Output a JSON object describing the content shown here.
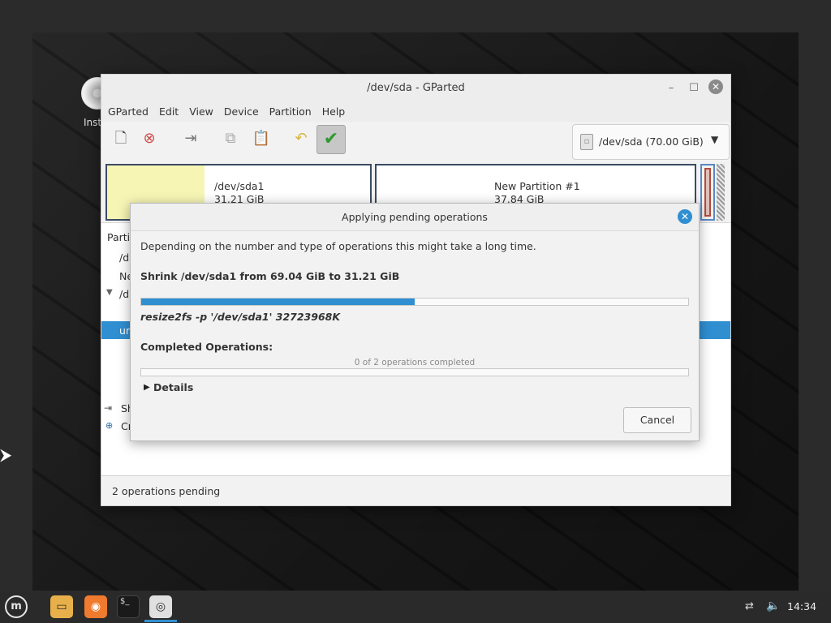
{
  "desktop": {
    "icon_label": "Inst"
  },
  "window": {
    "title": "/dev/sda - GParted",
    "menu": [
      "GParted",
      "Edit",
      "View",
      "Device",
      "Partition",
      "Help"
    ],
    "device_selector": "/dev/sda  (70.00 GiB)",
    "partitions": [
      {
        "name": "/dev/sda1",
        "size": "31.21 GiB"
      },
      {
        "name": "New Partition #1",
        "size": "37.84 GiB"
      }
    ],
    "list": {
      "header": "Parti",
      "rows": [
        "/d",
        "Ne",
        "/d"
      ],
      "selected_row": "un"
    },
    "operations": {
      "row1": "Sh",
      "row2": "Cr"
    },
    "status": "2 operations pending"
  },
  "dialog": {
    "title": "Applying pending operations",
    "description": "Depending on the number and type of operations this might take a long time.",
    "current_operation": "Shrink /dev/sda1 from 69.04 GiB to 31.21 GiB",
    "current_progress": 0.5,
    "command": "resize2fs -p '/dev/sda1' 32723968K",
    "completed_label": "Completed Operations:",
    "completed_text": "0 of 2 operations completed",
    "completed_progress": 0.0,
    "details_label": "Details",
    "cancel_label": "Cancel"
  },
  "taskbar": {
    "clock": "14:34"
  },
  "colors": {
    "accent": "#2f8fd1",
    "used_space": "#f6f5b4",
    "partition_border": "#3c4b64"
  }
}
